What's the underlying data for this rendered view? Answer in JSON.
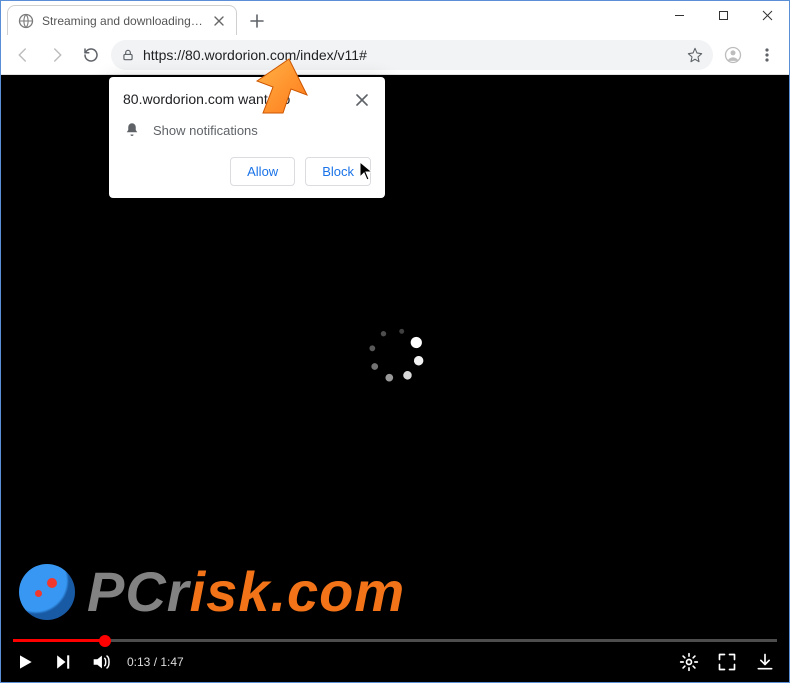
{
  "window": {
    "tab_title": "Streaming and downloading are",
    "controls": {
      "minimize": "min",
      "maximize": "max",
      "close": "close"
    }
  },
  "toolbar": {
    "url": "https://80.wordorion.com/index/v11#"
  },
  "permission": {
    "origin_text": "80.wordorion.com wants to",
    "row_label": "Show notifications",
    "allow_label": "Allow",
    "block_label": "Block"
  },
  "player": {
    "time_current": "0:13",
    "time_total": "1:47",
    "time_sep": " / ",
    "progress_percent": 12
  },
  "watermark": {
    "pcr": "PCr",
    "isk": "isk.com"
  }
}
